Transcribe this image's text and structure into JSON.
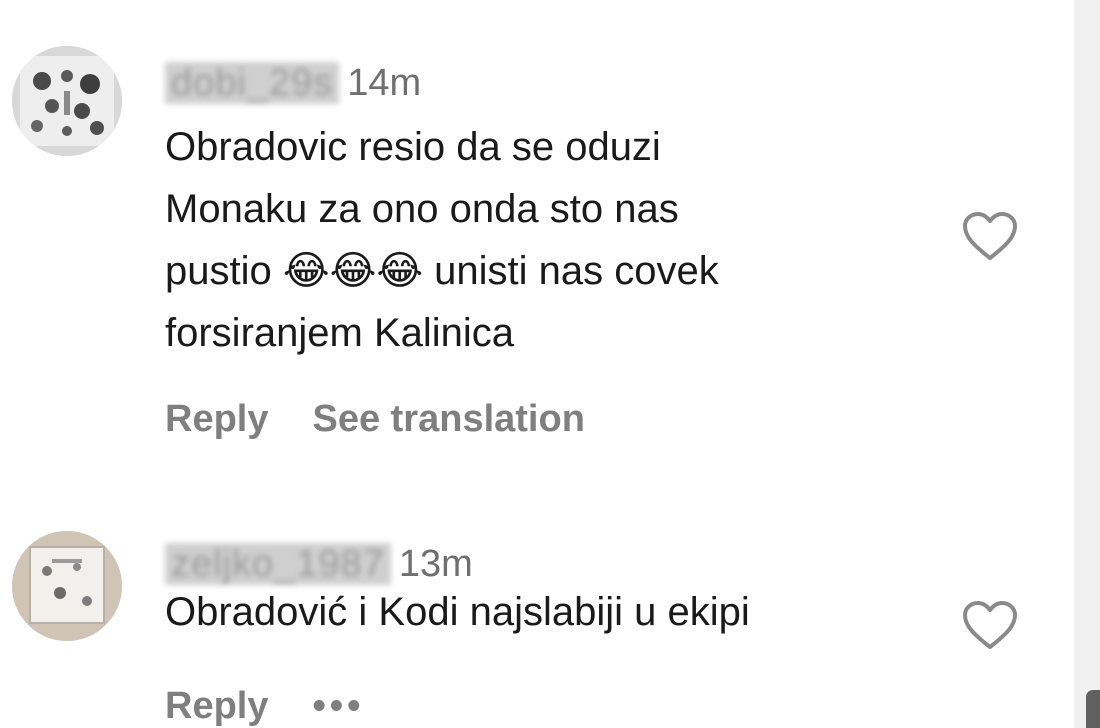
{
  "comments": [
    {
      "username": "dobi_29s",
      "time": "14m",
      "text": "Obradovic resio da se oduzi\nMonaku za ono onda sto nas\npustio 😂😂😂 unisti nas covek\nforsiranjem Kalinica",
      "actions": {
        "reply": "Reply",
        "translate": "See translation"
      },
      "avatar_icon": "avatar-image",
      "like_icon": "heart-outline-icon"
    },
    {
      "username": "zeljko_1987",
      "time": "13m",
      "text": "Obradović i Kodi najslabiji u ekipi",
      "actions": {
        "reply": "Reply",
        "more": "•••"
      },
      "avatar_icon": "avatar-image",
      "like_icon": "heart-outline-icon"
    }
  ],
  "colors": {
    "text": "#1a1a1a",
    "meta": "#6f6f6f",
    "action": "#7f7f7f",
    "heart": "#8a8a8a"
  }
}
